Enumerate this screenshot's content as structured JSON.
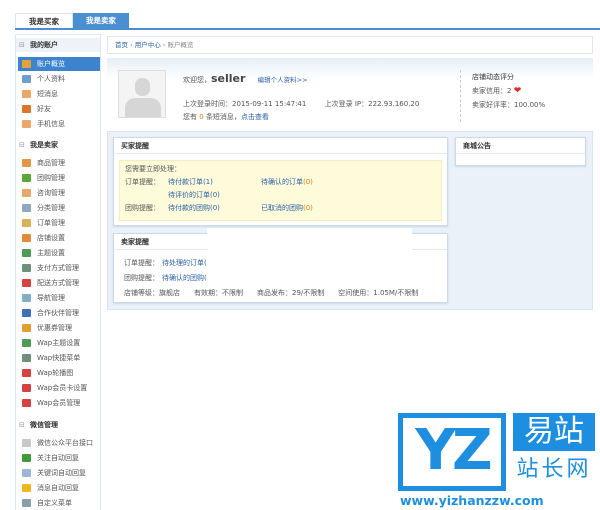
{
  "tabs": [
    {
      "label": "我是买家",
      "active": false
    },
    {
      "label": "我是卖家",
      "active": true
    }
  ],
  "sidebar": {
    "sections": [
      {
        "title": "我的账户",
        "items": [
          {
            "label": "账户概览",
            "active": true,
            "icon": "home-icon",
            "color": "#e8a13a"
          },
          {
            "label": "个人资料",
            "icon": "profile-card-icon",
            "color": "#6a9fd0"
          },
          {
            "label": "短消息",
            "icon": "envelope-icon",
            "color": "#e9a86b"
          },
          {
            "label": "好友",
            "icon": "friend-icon",
            "color": "#d9772f"
          },
          {
            "label": "手机信息",
            "icon": "mobile-message-icon",
            "color": "#e9a86b"
          }
        ]
      },
      {
        "title": "我是卖家",
        "items": [
          {
            "label": "商品管理",
            "icon": "goods-icon",
            "color": "#e0974a"
          },
          {
            "label": "团购管理",
            "icon": "group-buy-icon",
            "color": "#5aa83c"
          },
          {
            "label": "咨询管理",
            "icon": "consult-icon",
            "color": "#e9a86b"
          },
          {
            "label": "分类管理",
            "icon": "category-icon",
            "color": "#8fa7c2"
          },
          {
            "label": "订单管理",
            "icon": "order-icon",
            "color": "#d9b25a"
          },
          {
            "label": "店铺设置",
            "icon": "shop-icon",
            "color": "#e28a3a"
          },
          {
            "label": "主题设置",
            "icon": "theme-icon",
            "color": "#4f9a57"
          },
          {
            "label": "支付方式管理",
            "icon": "payment-icon",
            "color": "#6f8f78"
          },
          {
            "label": "配送方式管理",
            "icon": "delivery-icon",
            "color": "#d84141"
          },
          {
            "label": "导航管理",
            "icon": "navigation-icon",
            "color": "#7fb0c4"
          },
          {
            "label": "合作伙伴管理",
            "icon": "partner-icon",
            "color": "#3e6fb8"
          },
          {
            "label": "优惠券管理",
            "icon": "coupon-icon",
            "color": "#e0a030"
          },
          {
            "label": "Wap主题设置",
            "icon": "wap-theme-icon",
            "color": "#4f9a57"
          },
          {
            "label": "Wap快捷菜单",
            "icon": "wap-menu-icon",
            "color": "#6f8f78"
          },
          {
            "label": "Wap轮播图",
            "icon": "wap-slider-icon",
            "color": "#d84141"
          },
          {
            "label": "Wap会员卡设置",
            "icon": "wap-card-icon",
            "color": "#d84141"
          },
          {
            "label": "Wap会员管理",
            "icon": "wap-member-icon",
            "color": "#d84141"
          }
        ]
      },
      {
        "title": "微信管理",
        "items": [
          {
            "label": "微信公众平台接口",
            "icon": "document-icon",
            "color": "#c8c8c8"
          },
          {
            "label": "关注自动回复",
            "icon": "follow-reply-icon",
            "color": "#3f9a3a"
          },
          {
            "label": "关键词自动回复",
            "icon": "keyword-reply-icon",
            "color": "#9bb6d6"
          },
          {
            "label": "消息自动回复",
            "icon": "star-reply-icon",
            "color": "#f0b820"
          },
          {
            "label": "自定义菜单",
            "icon": "custom-menu-icon",
            "color": "#8aa0a8"
          }
        ]
      }
    ]
  },
  "breadcrumb": [
    "首页",
    "用户中心",
    "账户概览"
  ],
  "profile": {
    "welcome": "欢迎您，",
    "username": "seller",
    "edit_link": "编辑个人资料>>",
    "last_login_label": "上次登录时间：",
    "last_login": "2015-09-11 15:47:41",
    "last_ip_label": "上次登录 IP：",
    "last_ip": "222.93.160.20",
    "msg_prefix": "您有",
    "msg_count": "0",
    "msg_suffix": "条短消息，",
    "msg_link": "点击查看"
  },
  "rating": {
    "title": "店铺动态评分",
    "credit_label": "卖家信用：",
    "credit": "2",
    "praise_label": "卖家好评率：",
    "praise": "100.00%"
  },
  "buyer": {
    "title": "买家提醒",
    "notice": "您需要立即处理：",
    "order_label": "订单提醒：",
    "order_links": [
      {
        "text": "待付款订单",
        "count": "(1)"
      },
      {
        "text": "待确认的订单",
        "count": "(0)"
      },
      {
        "text": "待评价的订单",
        "count": "(0)"
      }
    ],
    "group_label": "团购提醒：",
    "group_links": [
      {
        "text": "待付款的团购",
        "count": "(0)"
      },
      {
        "text": "已取消的团购",
        "count": "(0)"
      }
    ]
  },
  "seller": {
    "title": "卖家提醒",
    "order_label": "订单提醒：",
    "order_link": "待处理的订单(",
    "group_label": "团购提醒：",
    "group_link": "待确认的团购(",
    "stats": [
      "店铺等级：旗舰店",
      "有效期：不限制",
      "商品发布：29/不限制",
      "空间使用：1.05M/不限制"
    ]
  },
  "notice": {
    "title": "商城公告"
  },
  "watermark": {
    "logo": "YZ",
    "cn1": "易站",
    "cn2": "站长网",
    "url": "www.yizhanzzw.com",
    "color": "#1e8fe0"
  }
}
